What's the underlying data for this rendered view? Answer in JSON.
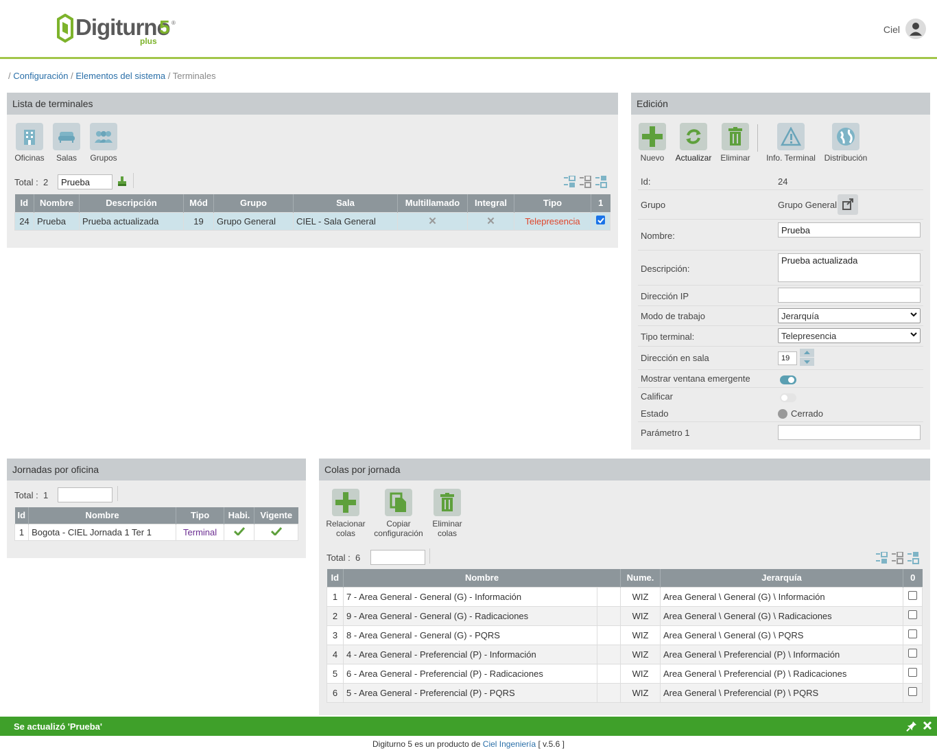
{
  "header": {
    "logo_name": "Digiturno",
    "logo_five": "5",
    "logo_reg": "®",
    "logo_plus": "plus",
    "user": "Ciel"
  },
  "breadcrumb": {
    "sep": "/",
    "items": [
      "Configuración",
      "Elementos del sistema"
    ],
    "current": "Terminales"
  },
  "terminals": {
    "title": "Lista de terminales",
    "tools": [
      "Oficinas",
      "Salas",
      "Grupos"
    ],
    "total_label": "Total :",
    "total": "2",
    "search": "Prueba",
    "columns": [
      "Id",
      "Nombre",
      "Descripción",
      "Mód",
      "Grupo",
      "Sala",
      "Multillamado",
      "Integral",
      "Tipo",
      "1"
    ],
    "rows": [
      {
        "id": "24",
        "nombre": "Prueba",
        "descripcion": "Prueba actualizada",
        "mod": "19",
        "grupo": "Grupo General",
        "sala": "CIEL - Sala General",
        "multillamado": "✕",
        "integral": "✕",
        "tipo": "Telepresencia"
      }
    ]
  },
  "edicion": {
    "title": "Edición",
    "tools": [
      "Nuevo",
      "Actualizar",
      "Eliminar",
      "Info. Terminal",
      "Distribución"
    ],
    "fields": {
      "id": {
        "label": "Id:",
        "value": "24"
      },
      "grupo": {
        "label": "Grupo",
        "value": "Grupo General"
      },
      "nombre": {
        "label": "Nombre:",
        "value": "Prueba"
      },
      "descripcion": {
        "label": "Descripción:",
        "value": "Prueba actualizada"
      },
      "ip": {
        "label": "Dirección IP",
        "value": ""
      },
      "modo": {
        "label": "Modo de trabajo",
        "value": "Jerarquía"
      },
      "tipo": {
        "label": "Tipo terminal:",
        "value": "Telepresencia"
      },
      "direccion": {
        "label": "Dirección en sala",
        "value": "19"
      },
      "mostrar": {
        "label": "Mostrar ventana emergente"
      },
      "calificar": {
        "label": "Calificar"
      },
      "estado": {
        "label": "Estado",
        "value": "Cerrado"
      },
      "parametro": {
        "label": "Parámetro 1",
        "value": ""
      }
    }
  },
  "jornadas": {
    "title": "Jornadas por oficina",
    "total_label": "Total :",
    "total": "1",
    "search": "",
    "columns": [
      "Id",
      "Nombre",
      "Tipo",
      "Habi.",
      "Vigente"
    ],
    "rows": [
      {
        "id": "1",
        "nombre": "Bogota - CIEL Jornada 1 Ter 1",
        "tipo": "Terminal"
      }
    ]
  },
  "colas": {
    "title": "Colas por jornada",
    "tools": [
      "Relacionar colas",
      "Copiar configuración",
      "Eliminar colas"
    ],
    "total_label": "Total :",
    "total": "6",
    "search": "",
    "columns": [
      "Id",
      "Nombre",
      "Nume.",
      "Jerarquía",
      "0"
    ],
    "rows": [
      {
        "id": "1",
        "nombre": "7 - Area General - General (G) - Información",
        "num": "WIZ",
        "jer": "Area General \\ General (G) \\ Información"
      },
      {
        "id": "2",
        "nombre": "9 - Area General - General (G) - Radicaciones",
        "num": "WIZ",
        "jer": "Area General \\ General (G) \\ Radicaciones"
      },
      {
        "id": "3",
        "nombre": "8 - Area General - General (G) - PQRS",
        "num": "WIZ",
        "jer": "Area General \\ General (G) \\ PQRS"
      },
      {
        "id": "4",
        "nombre": "4 - Area General - Preferencial (P) - Información",
        "num": "WIZ",
        "jer": "Area General \\ Preferencial (P) \\ Información"
      },
      {
        "id": "5",
        "nombre": "6 - Area General - Preferencial (P) - Radicaciones",
        "num": "WIZ",
        "jer": "Area General \\ Preferencial (P) \\ Radicaciones"
      },
      {
        "id": "6",
        "nombre": "5 - Area General - Preferencial (P) - PQRS",
        "num": "WIZ",
        "jer": "Area General \\ Preferencial (P) \\ PQRS"
      }
    ]
  },
  "notice": "Se actualizó 'Prueba'",
  "footer": {
    "text": "Digiturno 5 es un producto de",
    "link": "Ciel Ingeniería",
    "version": "[ v.5.6 ]"
  },
  "colors": {
    "accent": "#a2c64a",
    "green": "#5ea03c",
    "link": "#2a6fa8",
    "tipo": "#e0442a",
    "notice": "#3fa02a"
  }
}
